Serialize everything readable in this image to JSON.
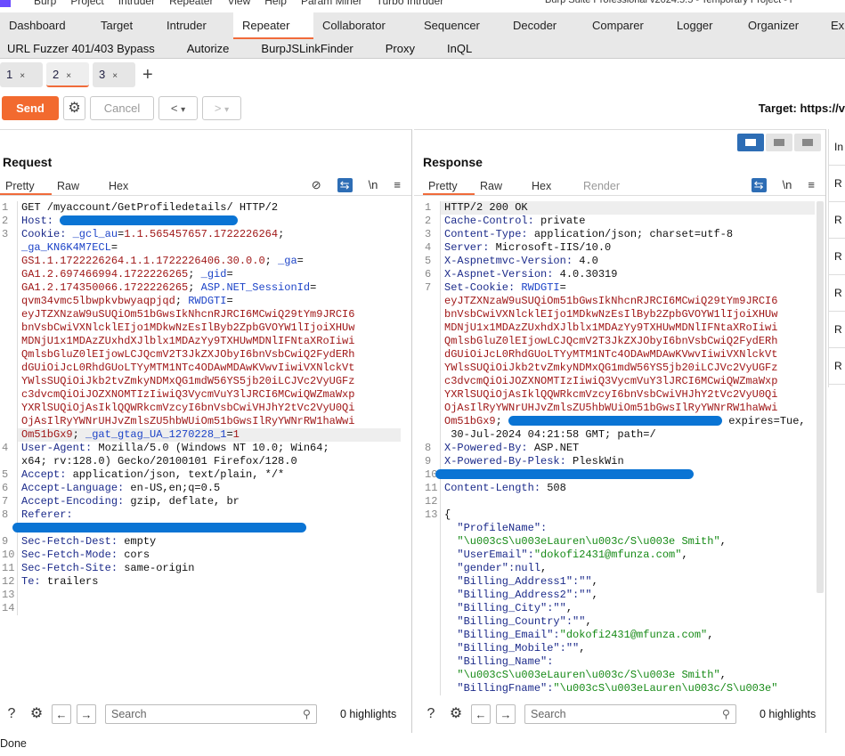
{
  "menubar": {
    "items": [
      "Burp",
      "Project",
      "Intruder",
      "Repeater",
      "View",
      "Help",
      "Param Miner",
      "Turbo Intruder"
    ],
    "window_title": "Burp Suite Professional v2024.5.5 - Temporary Project - l"
  },
  "main_tabs": [
    "Dashboard",
    "Target",
    "Intruder",
    "Repeater",
    "Collaborator",
    "Sequencer",
    "Decoder",
    "Comparer",
    "Logger",
    "Organizer",
    "Ex"
  ],
  "main_tab_active": "Repeater",
  "extension_tabs": [
    "URL Fuzzer 401/403 Bypass",
    "Autorize",
    "BurpJSLinkFinder",
    "Proxy",
    "InQL"
  ],
  "repeater_tabs": [
    {
      "label": "1",
      "close": "×"
    },
    {
      "label": "2",
      "close": "×",
      "active": true
    },
    {
      "label": "3",
      "close": "×"
    }
  ],
  "add_tab": "+",
  "toolbar": {
    "send": "Send",
    "cancel": "Cancel",
    "back": "<",
    "back_drop": "▾",
    "fwd": ">",
    "fwd_drop": "▾",
    "target": "Target: https://v"
  },
  "request": {
    "title": "Request",
    "tabs": [
      "Pretty",
      "Raw",
      "Hex"
    ],
    "icons": {
      "hide": "⊘",
      "wrap": "⇆",
      "newline": "\\n",
      "menu": "≡"
    },
    "lines": [
      {
        "n": "1",
        "segs": [
          [
            "GET /myaccount/GetProfiledetails/ HTTP/2",
            "p"
          ]
        ]
      },
      {
        "n": "2",
        "segs": [
          [
            "Host: ",
            "h"
          ],
          [
            "",
            "redact-host"
          ]
        ]
      },
      {
        "n": "3",
        "segs": [
          [
            "Cookie: ",
            "h"
          ],
          [
            "_gcl_au",
            "k"
          ],
          [
            "=",
            "p"
          ],
          [
            "1.1.565457657.1722226264",
            "v"
          ],
          [
            ";",
            "p"
          ]
        ]
      },
      {
        "n": "",
        "segs": [
          [
            "_ga_KN6K4M7ECL",
            "k"
          ],
          [
            "=",
            "p"
          ]
        ]
      },
      {
        "n": "",
        "segs": [
          [
            "GS1.1.1722226264.1.1.1722226406.30.0.0",
            "v"
          ],
          [
            "; ",
            "p"
          ],
          [
            "_ga",
            "k"
          ],
          [
            "=",
            "p"
          ]
        ]
      },
      {
        "n": "",
        "segs": [
          [
            "GA1.2.697466994.1722226265",
            "v"
          ],
          [
            "; ",
            "p"
          ],
          [
            "_gid",
            "k"
          ],
          [
            "=",
            "p"
          ]
        ]
      },
      {
        "n": "",
        "segs": [
          [
            "GA1.2.174350066.1722226265",
            "v"
          ],
          [
            "; ",
            "p"
          ],
          [
            "ASP.NET_SessionId",
            "k"
          ],
          [
            "=",
            "p"
          ]
        ]
      },
      {
        "n": "",
        "segs": [
          [
            "qvm34vmc5lbwpkvbwyaqpjqd",
            "v"
          ],
          [
            "; ",
            "p"
          ],
          [
            "RWDGTI",
            "k"
          ],
          [
            "=",
            "p"
          ]
        ]
      },
      {
        "n": "",
        "segs": [
          [
            "eyJTZXNzaW9uSUQiOm51bGwsIkNhcnRJRCI6MCwiQ29tYm9JRCI6",
            "v"
          ]
        ]
      },
      {
        "n": "",
        "segs": [
          [
            "bnVsbCwiVXNlcklEIjo1MDkwNzEsIlByb2ZpbGVOYW1lIjoiXHUw",
            "v"
          ]
        ]
      },
      {
        "n": "",
        "segs": [
          [
            "MDNjU1x1MDAzZUxhdXJlblx1MDAzYy9TXHUwMDNlIFNtaXRoIiwi",
            "v"
          ]
        ]
      },
      {
        "n": "",
        "segs": [
          [
            "QmlsbGluZ0lEIjowLCJQcmV2T3JkZXJObyI6bnVsbCwiQ2FydERh",
            "v"
          ]
        ]
      },
      {
        "n": "",
        "segs": [
          [
            "dGUiOiJcL0RhdGUoLTYyMTM1NTc4ODAwMDAwKVwvIiwiVXNlckVt",
            "v"
          ]
        ]
      },
      {
        "n": "",
        "segs": [
          [
            "YWlsSUQiOiJkb2tvZmkyNDMxQG1mdW56YS5jb20iLCJVc2VyUGFz",
            "v"
          ]
        ]
      },
      {
        "n": "",
        "segs": [
          [
            "c3dvcmQiOiJOZXNOMTIzIiwiQ3VycmVuY3lJRCI6MCwiQWZmaWxp",
            "v"
          ]
        ]
      },
      {
        "n": "",
        "segs": [
          [
            "YXRlSUQiOjAsIklQQWRkcmVzcyI6bnVsbCwiVHJhY2tVc2VyU0Qi",
            "v"
          ]
        ]
      },
      {
        "n": "",
        "segs": [
          [
            "OjAsIlRyYWNrUHJvZmlsZU5hbWUiOm51bGwsIlRyYWNrRW1haWwi",
            "v"
          ]
        ]
      },
      {
        "n": "",
        "hl": true,
        "segs": [
          [
            "Om51bGx9",
            "v"
          ],
          [
            "; ",
            "p"
          ],
          [
            "_gat_gtag_UA_1270228_1",
            "k"
          ],
          [
            "=",
            "p"
          ],
          [
            "1",
            "v"
          ]
        ]
      },
      {
        "n": "4",
        "segs": [
          [
            "User-Agent: ",
            "h"
          ],
          [
            "Mozilla/5.0 (Windows NT 10.0; Win64;",
            "p"
          ]
        ]
      },
      {
        "n": "",
        "segs": [
          [
            "x64; rv:128.0) Gecko/20100101 Firefox/128.0",
            "p"
          ]
        ]
      },
      {
        "n": "5",
        "segs": [
          [
            "Accept: ",
            "h"
          ],
          [
            "application/json, text/plain, */*",
            "p"
          ]
        ]
      },
      {
        "n": "6",
        "segs": [
          [
            "Accept-Language: ",
            "h"
          ],
          [
            "en-US,en;q=0.5",
            "p"
          ]
        ]
      },
      {
        "n": "7",
        "segs": [
          [
            "Accept-Encoding: ",
            "h"
          ],
          [
            "gzip, deflate, br",
            "p"
          ]
        ]
      },
      {
        "n": "8",
        "segs": [
          [
            "Referer: ",
            "h"
          ]
        ]
      },
      {
        "n": "",
        "segs": [
          [
            "",
            "redact-referer"
          ]
        ]
      },
      {
        "n": "9",
        "segs": [
          [
            "Sec-Fetch-Dest: ",
            "h"
          ],
          [
            "empty",
            "p"
          ]
        ]
      },
      {
        "n": "10",
        "segs": [
          [
            "Sec-Fetch-Mode: ",
            "h"
          ],
          [
            "cors",
            "p"
          ]
        ]
      },
      {
        "n": "11",
        "segs": [
          [
            "Sec-Fetch-Site: ",
            "h"
          ],
          [
            "same-origin",
            "p"
          ]
        ]
      },
      {
        "n": "12",
        "segs": [
          [
            "Te: ",
            "h"
          ],
          [
            "trailers",
            "p"
          ]
        ]
      },
      {
        "n": "13",
        "segs": []
      },
      {
        "n": "14",
        "segs": []
      }
    ],
    "search_placeholder": "Search",
    "highlights": "0 highlights"
  },
  "response": {
    "title": "Response",
    "tabs": [
      "Pretty",
      "Raw",
      "Hex",
      "Render"
    ],
    "icons": {
      "wrap": "⇆",
      "newline": "\\n",
      "menu": "≡"
    },
    "lines": [
      {
        "n": "1",
        "hl": true,
        "segs": [
          [
            "HTTP/2 200 OK",
            "p"
          ]
        ]
      },
      {
        "n": "2",
        "segs": [
          [
            "Cache-Control: ",
            "h"
          ],
          [
            "private",
            "p"
          ]
        ]
      },
      {
        "n": "3",
        "segs": [
          [
            "Content-Type: ",
            "h"
          ],
          [
            "application/json; charset=utf-8",
            "p"
          ]
        ]
      },
      {
        "n": "4",
        "segs": [
          [
            "Server: ",
            "h"
          ],
          [
            "Microsoft-IIS/10.0",
            "p"
          ]
        ]
      },
      {
        "n": "5",
        "segs": [
          [
            "X-Aspnetmvc-Version: ",
            "h"
          ],
          [
            "4.0",
            "p"
          ]
        ]
      },
      {
        "n": "6",
        "segs": [
          [
            "X-Aspnet-Version: ",
            "h"
          ],
          [
            "4.0.30319",
            "p"
          ]
        ]
      },
      {
        "n": "7",
        "segs": [
          [
            "Set-Cookie: ",
            "h"
          ],
          [
            "RWDGTI",
            "k"
          ],
          [
            "=",
            "p"
          ]
        ]
      },
      {
        "n": "",
        "segs": [
          [
            "eyJTZXNzaW9uSUQiOm51bGwsIkNhcnRJRCI6MCwiQ29tYm9JRCI6",
            "v"
          ]
        ]
      },
      {
        "n": "",
        "segs": [
          [
            "bnVsbCwiVXNlcklEIjo1MDkwNzEsIlByb2ZpbGVOYW1lIjoiXHUw",
            "v"
          ]
        ]
      },
      {
        "n": "",
        "segs": [
          [
            "MDNjU1x1MDAzZUxhdXJlblx1MDAzYy9TXHUwMDNlIFNtaXRoIiwi",
            "v"
          ]
        ]
      },
      {
        "n": "",
        "segs": [
          [
            "QmlsbGluZ0lEIjowLCJQcmV2T3JkZXJObyI6bnVsbCwiQ2FydERh",
            "v"
          ]
        ]
      },
      {
        "n": "",
        "segs": [
          [
            "dGUiOiJcL0RhdGUoLTYyMTM1NTc4ODAwMDAwKVwvIiwiVXNlckVt",
            "v"
          ]
        ]
      },
      {
        "n": "",
        "segs": [
          [
            "YWlsSUQiOiJkb2tvZmkyNDMxQG1mdW56YS5jb20iLCJVc2VyUGFz",
            "v"
          ]
        ]
      },
      {
        "n": "",
        "segs": [
          [
            "c3dvcmQiOiJOZXNOMTIzIiwiQ3VycmVuY3lJRCI6MCwiQWZmaWxp",
            "v"
          ]
        ]
      },
      {
        "n": "",
        "segs": [
          [
            "YXRlSUQiOjAsIklQQWRkcmVzcyI6bnVsbCwiVHJhY2tVc2VyU0Qi",
            "v"
          ]
        ]
      },
      {
        "n": "",
        "segs": [
          [
            "OjAsIlRyYWNrUHJvZmlsZU5hbWUiOm51bGwsIlRyYWNrRW1haWwi",
            "v"
          ]
        ]
      },
      {
        "n": "",
        "segs": [
          [
            "Om51bGx9",
            "v"
          ],
          [
            "; ",
            "p"
          ],
          [
            "",
            "redact-cookie"
          ],
          [
            " expires=Tue,",
            "p"
          ]
        ]
      },
      {
        "n": "",
        "segs": [
          [
            " 30-Jul-2024 04:21:58 GMT; path=/",
            "p"
          ]
        ]
      },
      {
        "n": "8",
        "segs": [
          [
            "X-Powered-By: ",
            "h"
          ],
          [
            "ASP.NET",
            "p"
          ]
        ]
      },
      {
        "n": "9",
        "segs": [
          [
            "X-Powered-By-Plesk: ",
            "h"
          ],
          [
            "PleskWin",
            "p"
          ]
        ]
      },
      {
        "n": "10",
        "segs": [
          [
            "",
            "redact-header"
          ]
        ]
      },
      {
        "n": "11",
        "segs": [
          [
            "Content-Length: ",
            "h"
          ],
          [
            "508",
            "p"
          ]
        ]
      },
      {
        "n": "12",
        "segs": []
      },
      {
        "n": "13",
        "segs": [
          [
            "{",
            "p"
          ]
        ]
      },
      {
        "n": "",
        "segs": [
          [
            "  \"ProfileName\":",
            "h"
          ]
        ]
      },
      {
        "n": "",
        "segs": [
          [
            "  \"\\u003cS\\u003eLauren\\u003c/S\\u003e Smith\"",
            "s"
          ],
          [
            ",",
            "p"
          ]
        ]
      },
      {
        "n": "",
        "segs": [
          [
            "  \"UserEmail\":",
            "h"
          ],
          [
            "\"dokofi2431@mfunza.com\"",
            "s"
          ],
          [
            ",",
            "p"
          ]
        ]
      },
      {
        "n": "",
        "segs": [
          [
            "  \"gender\":",
            "h"
          ],
          [
            "null",
            "h"
          ],
          [
            ",",
            "p"
          ]
        ]
      },
      {
        "n": "",
        "segs": [
          [
            "  \"Billing_Address1\":",
            "h"
          ],
          [
            "\"\"",
            "h"
          ],
          [
            ",",
            "p"
          ]
        ]
      },
      {
        "n": "",
        "segs": [
          [
            "  \"Billing_Address2\":",
            "h"
          ],
          [
            "\"\"",
            "h"
          ],
          [
            ",",
            "p"
          ]
        ]
      },
      {
        "n": "",
        "segs": [
          [
            "  \"Billing_City\":",
            "h"
          ],
          [
            "\"\"",
            "h"
          ],
          [
            ",",
            "p"
          ]
        ]
      },
      {
        "n": "",
        "segs": [
          [
            "  \"Billing_Country\":",
            "h"
          ],
          [
            "\"\"",
            "h"
          ],
          [
            ",",
            "p"
          ]
        ]
      },
      {
        "n": "",
        "segs": [
          [
            "  \"Billing_Email\":",
            "h"
          ],
          [
            "\"dokofi2431@mfunza.com\"",
            "s"
          ],
          [
            ",",
            "p"
          ]
        ]
      },
      {
        "n": "",
        "segs": [
          [
            "  \"Billing_Mobile\":",
            "h"
          ],
          [
            "\"\"",
            "h"
          ],
          [
            ",",
            "p"
          ]
        ]
      },
      {
        "n": "",
        "segs": [
          [
            "  \"Billing_Name\":",
            "h"
          ]
        ]
      },
      {
        "n": "",
        "segs": [
          [
            "  \"\\u003cS\\u003eLauren\\u003c/S\\u003e Smith\"",
            "s"
          ],
          [
            ",",
            "p"
          ]
        ]
      },
      {
        "n": "",
        "segs": [
          [
            "  \"BillingFname\":",
            "h"
          ],
          [
            "\"\\u003cS\\u003eLauren\\u003c/S\\u003e\"",
            "s"
          ]
        ]
      }
    ],
    "search_placeholder": "Search",
    "highlights": "0 highlights"
  },
  "inspector": {
    "title": "In",
    "items": [
      "R",
      "R",
      "R",
      "R",
      "R",
      "R"
    ]
  },
  "status": "Done",
  "colors": {
    "accent": "#f26a2f",
    "redaction": "#0a74d4",
    "selected_toggle": "#2d6db5"
  }
}
